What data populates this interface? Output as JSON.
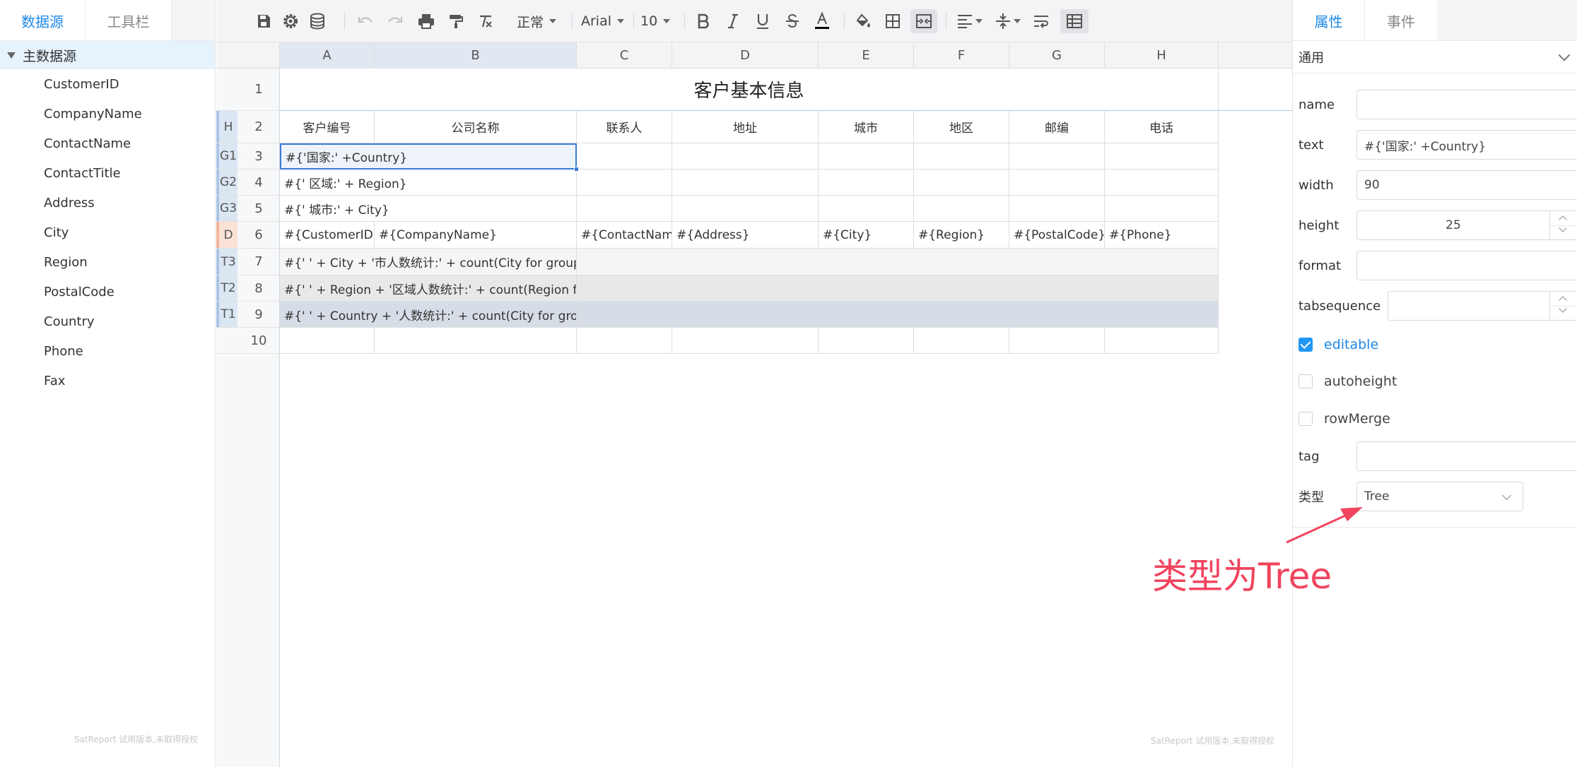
{
  "left_panel": {
    "tabs": [
      "数据源",
      "工具栏"
    ],
    "root_label": "主数据源",
    "fields": [
      "CustomerID",
      "CompanyName",
      "ContactName",
      "ContactTitle",
      "Address",
      "City",
      "Region",
      "PostalCode",
      "Country",
      "Phone",
      "Fax"
    ],
    "watermark": "SatReport 试用版本,未取得授权"
  },
  "toolbar": {
    "style_select": "正常",
    "font_select": "Arial",
    "size_select": "10",
    "icons": [
      "save-icon",
      "settings-icon",
      "database-icon",
      "undo-icon",
      "redo-icon",
      "print-icon",
      "format-painter-icon",
      "clear-format-icon",
      "bold-icon",
      "italic-icon",
      "underline-icon",
      "strikethrough-icon",
      "font-color-icon",
      "fill-color-icon",
      "border-icon",
      "merge-cells-icon",
      "align-horizontal-icon",
      "align-vertical-icon",
      "wrap-text-icon",
      "freeze-icon"
    ],
    "font_color": "#000000"
  },
  "sheet": {
    "columns": [
      "A",
      "B",
      "C",
      "D",
      "E",
      "F",
      "G",
      "H"
    ],
    "rows": [
      {
        "tag": "",
        "num": "1"
      },
      {
        "tag": "H",
        "num": "2"
      },
      {
        "tag": "G1",
        "num": "3"
      },
      {
        "tag": "G2",
        "num": "4"
      },
      {
        "tag": "G3",
        "num": "5"
      },
      {
        "tag": "D",
        "num": "6"
      },
      {
        "tag": "T3",
        "num": "7"
      },
      {
        "tag": "T2",
        "num": "8"
      },
      {
        "tag": "T1",
        "num": "9"
      },
      {
        "tag": "",
        "num": "10"
      }
    ],
    "title": "客户基本信息",
    "headers": [
      "客户编号",
      "公司名称",
      "联系人",
      "地址",
      "城市",
      "地区",
      "邮编",
      "电话"
    ],
    "group1": "#{'国家:' +Country}",
    "group2": "#{'  区域:' + Region}",
    "group3": "#{'    城市:' + City}",
    "detail": [
      "#{CustomerID}",
      "#{CompanyName}",
      "#{ContactName}",
      "#{Address}",
      "#{City}",
      "#{Region}",
      "#{PostalCode}",
      "#{Phone}"
    ],
    "total3": "#{'    ' + City + '市人数统计:' + count(City for group",
    "total2": "#{'  ' + Region + '区域人数统计:' + count(Region f",
    "total1": "#{'  ' + Country + '人数统计:' + count(City for grou",
    "watermark": "SatReport 试用版本,未取得授权"
  },
  "right_panel": {
    "tabs": [
      "属性",
      "事件"
    ],
    "section": "通用",
    "props": {
      "name_label": "name",
      "name_value": "",
      "text_label": "text",
      "text_value": "#{'国家:' +Country}",
      "width_label": "width",
      "width_value": "90",
      "height_label": "height",
      "height_value": "25",
      "format_label": "format",
      "format_value": "",
      "tabsequence_label": "tabsequence",
      "tabsequence_value": "",
      "editable_label": "editable",
      "autoheight_label": "autoheight",
      "rowmerge_label": "rowMerge",
      "tag_label": "tag",
      "tag_value": "",
      "type_label": "类型",
      "type_value": "Tree"
    },
    "checks": {
      "editable": true,
      "autoheight": false,
      "rowmerge": false
    }
  },
  "annotation": {
    "text": "类型为Tree",
    "color": "#f0445e"
  }
}
